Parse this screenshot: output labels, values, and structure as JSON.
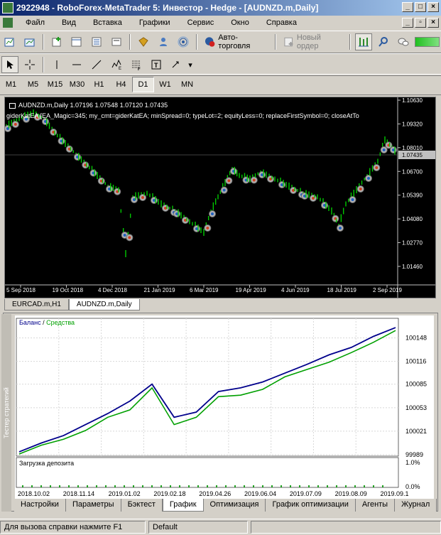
{
  "window": {
    "title": "2922948 - RoboForex-MetaTrader 5: Инвестор - Hedge - [AUDNZD.m,Daily]"
  },
  "menu": [
    "Файл",
    "Вид",
    "Вставка",
    "Графики",
    "Сервис",
    "Окно",
    "Справка"
  ],
  "toolbar": {
    "autotrading_label": "Авто-торговля",
    "new_order_label": "Новый ордер"
  },
  "timeframes": [
    "M1",
    "M5",
    "M15",
    "M30",
    "H1",
    "H4",
    "D1",
    "W1",
    "MN"
  ],
  "active_timeframe": "D1",
  "chart": {
    "info_line": "AUDNZD.m,Daily  1.07196 1.07548 1.07120 1.07435",
    "ea_line": "giderKatEA [EA_Magic=345; my_cmt=giderKatEA; minSpread=0; typeLot=2; equityLess=0; replaceFirstSymbol=0; closeAtTo",
    "price_labels": [
      "1.10630",
      "1.09320",
      "1.08010",
      "1.06700",
      "1.05390",
      "1.04080",
      "1.02770",
      "1.01460"
    ],
    "current_price": "1.07435",
    "date_labels": [
      "5 Sep 2018",
      "19 Oct 2018",
      "4 Dec 2018",
      "21 Jan 2019",
      "6 Mar 2019",
      "19 Apr 2019",
      "4 Jun 2019",
      "18 Jul 2019",
      "2 Sep 2019"
    ],
    "colors": {
      "bg": "#000000",
      "candle": "#00c800",
      "price_label_bg": "#c0c0c0"
    }
  },
  "chart_tabs": [
    "EURCAD.m,H1",
    "AUDNZD.m,Daily"
  ],
  "active_chart_tab": "AUDNZD.m,Daily",
  "tester": {
    "side_label": "Тестер стратегий",
    "legend_balance": "Баланс",
    "legend_sep": " / ",
    "legend_equity": "Средства",
    "y_labels": [
      "100148",
      "100116",
      "100085",
      "100053",
      "100021",
      "99989"
    ],
    "deposit_label": "Загрузка депозита",
    "deposit_ticks": [
      "1.0%",
      "0.0%"
    ],
    "x_labels": [
      "2018.10.02",
      "2018.11.14",
      "2019.01.02",
      "2019.02.18",
      "2019.04.26",
      "2019.06.04",
      "2019.07.09",
      "2019.08.09",
      "2019.09.1"
    ],
    "tabs": [
      "Настройки",
      "Параметры",
      "Бэктест",
      "График",
      "Оптимизация",
      "График оптимизации",
      "Агенты",
      "Журнал"
    ],
    "active_tab": "График",
    "colors": {
      "balance": "#00008b",
      "equity": "#00a000"
    }
  },
  "chart_data": {
    "type": "line",
    "title": "",
    "series": [
      {
        "name": "Баланс",
        "values": [
          99993,
          100005,
          100015,
          100030,
          100045,
          100062,
          100085,
          100040,
          100047,
          100075,
          100080,
          100088,
          100100,
          100112,
          100125,
          100135,
          100150,
          100162
        ]
      },
      {
        "name": "Средства",
        "values": [
          99990,
          100002,
          100010,
          100022,
          100040,
          100050,
          100080,
          100030,
          100040,
          100068,
          100070,
          100078,
          100095,
          100105,
          100115,
          100128,
          100142,
          100158
        ]
      }
    ],
    "x": [
      "2018.10.02",
      "2018.11.14",
      "2019.01.02",
      "2019.02.18",
      "2019.04.26",
      "2019.06.04",
      "2019.07.09",
      "2019.08.09",
      "2019.09.1"
    ],
    "ylim": [
      99989,
      100165
    ]
  },
  "status": {
    "help": "Для вызова справки нажмите F1",
    "profile": "Default"
  }
}
